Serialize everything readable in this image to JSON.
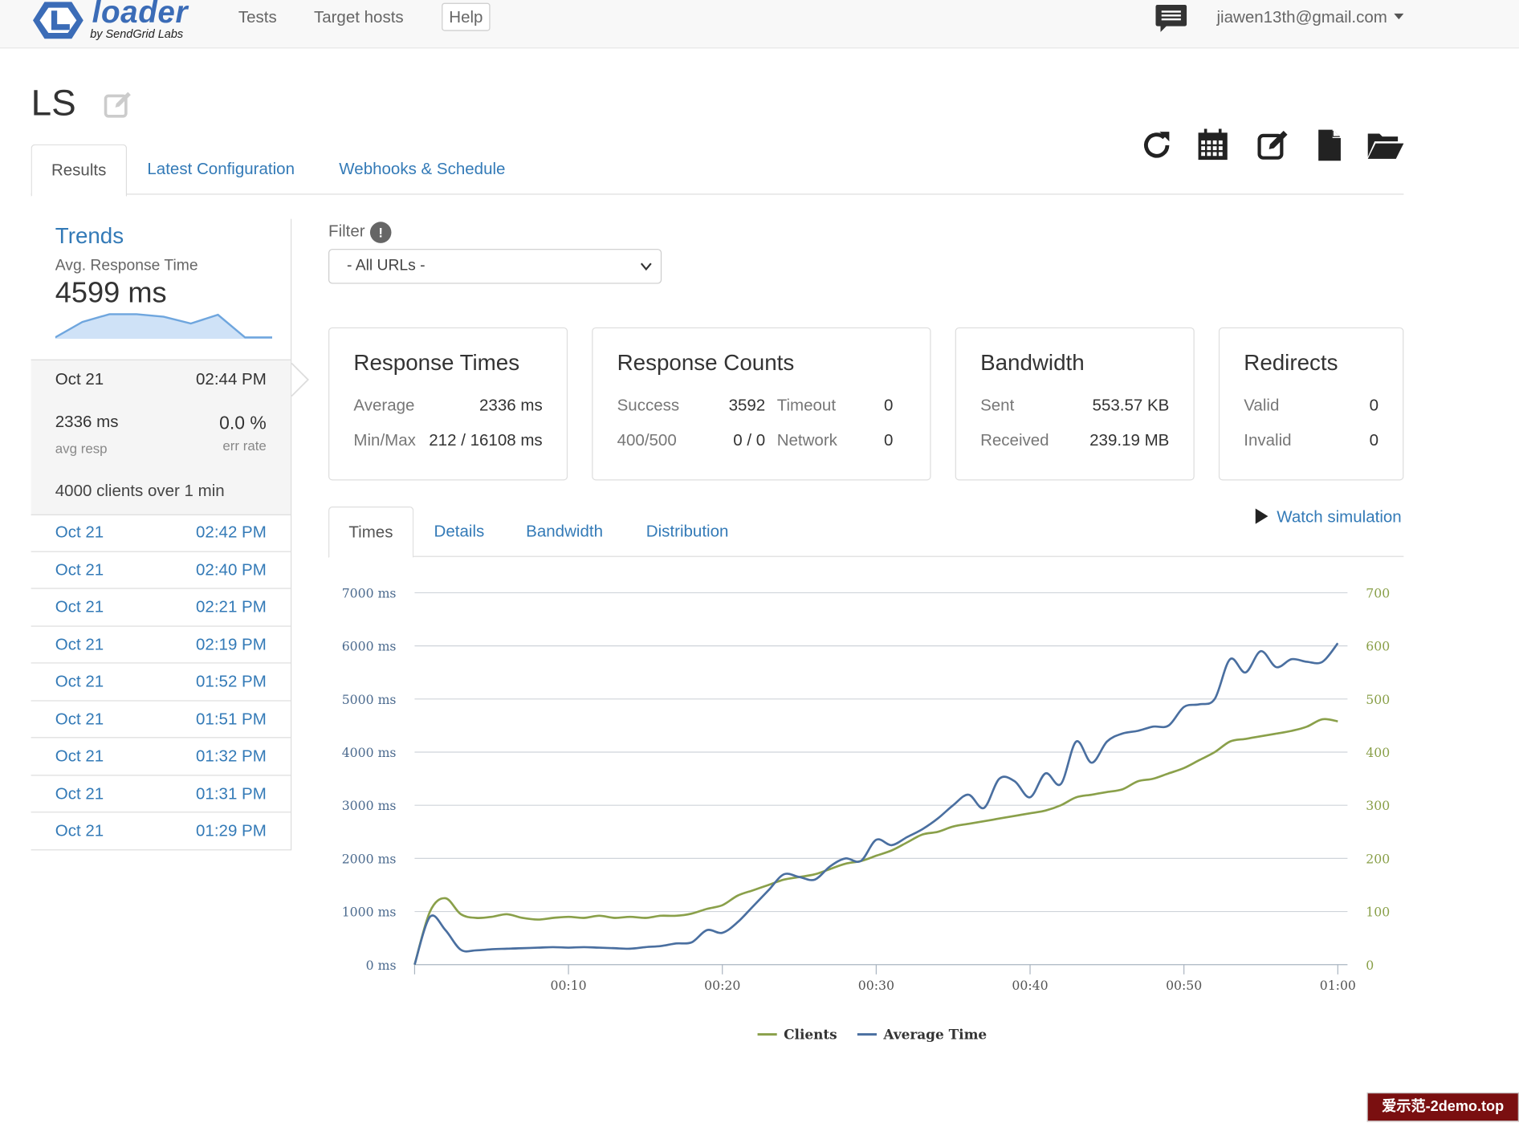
{
  "navbar": {
    "brand": "loader",
    "brand_sub": "by SendGrid Labs",
    "links": [
      "Tests",
      "Target hosts"
    ],
    "help": "Help",
    "user": "jiawen13th@gmail.com",
    "chat_icon": "chat-bubble-icon",
    "caret_icon": "caret-down-icon"
  },
  "page": {
    "title": "LS",
    "edit_icon": "edit-icon"
  },
  "toolbar": {
    "icons": [
      "refresh-icon",
      "calendar-icon",
      "edit-icon",
      "file-icon",
      "folder-open-icon"
    ]
  },
  "tabs": [
    "Results",
    "Latest Configuration",
    "Webhooks & Schedule"
  ],
  "trends": {
    "title": "Trends",
    "subtitle": "Avg. Response Time",
    "value": "4599 ms",
    "sparkline": [
      0.05,
      0.55,
      0.8,
      0.8,
      0.72,
      0.5,
      0.78,
      0.05,
      0.05
    ]
  },
  "current_run": {
    "date": "Oct 21",
    "time": "02:44 PM",
    "avg_resp": "2336 ms",
    "avg_resp_label": "avg resp",
    "err_rate": "0.0 %",
    "err_rate_label": "err rate",
    "clients_summary": "4000 clients over 1 min"
  },
  "runs": [
    {
      "date": "Oct 21",
      "time": "02:42 PM"
    },
    {
      "date": "Oct 21",
      "time": "02:40 PM"
    },
    {
      "date": "Oct 21",
      "time": "02:21 PM"
    },
    {
      "date": "Oct 21",
      "time": "02:19 PM"
    },
    {
      "date": "Oct 21",
      "time": "01:52 PM"
    },
    {
      "date": "Oct 21",
      "time": "01:51 PM"
    },
    {
      "date": "Oct 21",
      "time": "01:32 PM"
    },
    {
      "date": "Oct 21",
      "time": "01:31 PM"
    },
    {
      "date": "Oct 21",
      "time": "01:29 PM"
    }
  ],
  "filter": {
    "label": "Filter",
    "info": "!",
    "selected": "- All URLs -"
  },
  "cards": {
    "response_times": {
      "title": "Response Times",
      "average_label": "Average",
      "average": "2336 ms",
      "minmax_label": "Min/Max",
      "minmax": "212 / 16108 ms"
    },
    "response_counts": {
      "title": "Response Counts",
      "success_label": "Success",
      "success": "3592",
      "timeout_label": "Timeout",
      "timeout": "0",
      "e400_label": "400/500",
      "e400": "0 / 0",
      "network_label": "Network",
      "network": "0"
    },
    "bandwidth": {
      "title": "Bandwidth",
      "sent_label": "Sent",
      "sent": "553.57 KB",
      "received_label": "Received",
      "received": "239.19 MB"
    },
    "redirects": {
      "title": "Redirects",
      "valid_label": "Valid",
      "valid": "0",
      "invalid_label": "Invalid",
      "invalid": "0"
    }
  },
  "chart_tabs": [
    "Times",
    "Details",
    "Bandwidth",
    "Distribution"
  ],
  "watch_simulation": "Watch simulation",
  "chart_data": {
    "type": "line",
    "x_ticks": [
      "00:10",
      "00:20",
      "00:30",
      "00:40",
      "00:50",
      "01:00"
    ],
    "y_left_ticks": [
      "0 ms",
      "1000 ms",
      "2000 ms",
      "3000 ms",
      "4000 ms",
      "5000 ms",
      "6000 ms",
      "7000 ms"
    ],
    "y_right_ticks": [
      "0",
      "100",
      "200",
      "300",
      "400",
      "500",
      "600",
      "700"
    ],
    "ylim_left": [
      0,
      7000
    ],
    "ylim_right": [
      0,
      700
    ],
    "xlim_seconds": [
      0,
      60
    ],
    "series": [
      {
        "name": "Clients",
        "axis": "right",
        "color": "#8aa04a",
        "x": [
          0,
          1,
          2,
          3,
          4,
          5,
          6,
          7,
          8,
          9,
          10,
          11,
          12,
          13,
          14,
          15,
          16,
          17,
          18,
          19,
          20,
          21,
          22,
          23,
          24,
          25,
          26,
          27,
          28,
          29,
          30,
          31,
          32,
          33,
          34,
          35,
          36,
          37,
          38,
          39,
          40,
          41,
          42,
          43,
          44,
          45,
          46,
          47,
          48,
          49,
          50,
          51,
          52,
          53,
          54,
          55,
          56,
          57,
          58,
          59,
          60
        ],
        "values": [
          0,
          100,
          125,
          95,
          88,
          90,
          95,
          88,
          85,
          88,
          90,
          88,
          92,
          88,
          90,
          88,
          92,
          92,
          96,
          105,
          112,
          130,
          140,
          150,
          160,
          165,
          170,
          180,
          190,
          195,
          205,
          215,
          230,
          245,
          250,
          260,
          265,
          270,
          275,
          280,
          285,
          290,
          300,
          315,
          320,
          325,
          330,
          345,
          350,
          360,
          370,
          385,
          400,
          420,
          425,
          430,
          435,
          440,
          448,
          462,
          458
        ]
      },
      {
        "name": "Average Time",
        "axis": "left",
        "color": "#4a6fa0",
        "x": [
          0,
          1,
          2,
          3,
          4,
          5,
          6,
          7,
          8,
          9,
          10,
          11,
          12,
          13,
          14,
          15,
          16,
          17,
          18,
          19,
          20,
          21,
          22,
          23,
          24,
          25,
          26,
          27,
          28,
          29,
          30,
          31,
          32,
          33,
          34,
          35,
          36,
          37,
          38,
          39,
          40,
          41,
          42,
          43,
          44,
          45,
          46,
          47,
          48,
          49,
          50,
          51,
          52,
          53,
          54,
          55,
          56,
          57,
          58,
          59,
          60
        ],
        "values": [
          0,
          900,
          650,
          280,
          270,
          290,
          300,
          310,
          320,
          330,
          320,
          330,
          320,
          310,
          300,
          330,
          350,
          400,
          420,
          650,
          600,
          800,
          1100,
          1400,
          1700,
          1650,
          1600,
          1850,
          2000,
          1950,
          2350,
          2250,
          2400,
          2550,
          2750,
          3000,
          3200,
          2950,
          3500,
          3450,
          3150,
          3600,
          3400,
          4200,
          3800,
          4200,
          4350,
          4400,
          4480,
          4500,
          4850,
          4900,
          5000,
          5750,
          5500,
          5900,
          5600,
          5750,
          5700,
          5700,
          6050
        ]
      }
    ]
  },
  "watermark": "爱示范-2demo.top"
}
